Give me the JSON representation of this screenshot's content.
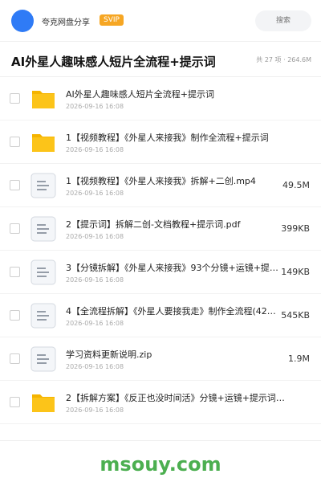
{
  "header": {
    "username": "夸克网盘分享",
    "badge": "SVIP",
    "search_placeholder": "搜索"
  },
  "folder": {
    "title": "AI外星人趣味感人短片全流程+提示词",
    "meta": "共 27 项 · 264.6M"
  },
  "items": [
    {
      "type": "folder",
      "name": "AI外星人趣味感人短片全流程+提示词",
      "date": "2026-09-16 16:08",
      "size": ""
    },
    {
      "type": "folder",
      "name": "1【视频教程】《外星人来接我》制作全流程+提示词",
      "date": "2026-09-16 16:08",
      "size": ""
    },
    {
      "type": "file",
      "name": "1【视频教程】《外星人来接我》拆解+二创.mp4",
      "date": "2026-09-16 16:08",
      "size": "49.5M"
    },
    {
      "type": "file",
      "name": "2【提示词】拆解二创-文档教程+提示词.pdf",
      "date": "2026-09-16 16:08",
      "size": "399KB"
    },
    {
      "type": "file",
      "name": "3【分镜拆解】《外星人来接我》93个分镜+运镜+提…",
      "date": "2026-09-16 16:08",
      "size": "149KB"
    },
    {
      "type": "file",
      "name": "4【全流程拆解】《外星人要接我走》制作全流程(42…",
      "date": "2026-09-16 16:08",
      "size": "545KB"
    },
    {
      "type": "file",
      "name": "学习资料更新说明.zip",
      "date": "2026-09-16 16:08",
      "size": "1.9M"
    },
    {
      "type": "folder",
      "name": "2【拆解方案】《反正也没时间活》分镜+运镜+提示词…",
      "date": "2026-09-16 16:08",
      "size": ""
    }
  ],
  "watermark": "msouy.com",
  "colors": {
    "avatar": "#2f7bf6",
    "svip": "#f6a623",
    "folder": "#fcc419",
    "watermark": "#4caf50"
  }
}
